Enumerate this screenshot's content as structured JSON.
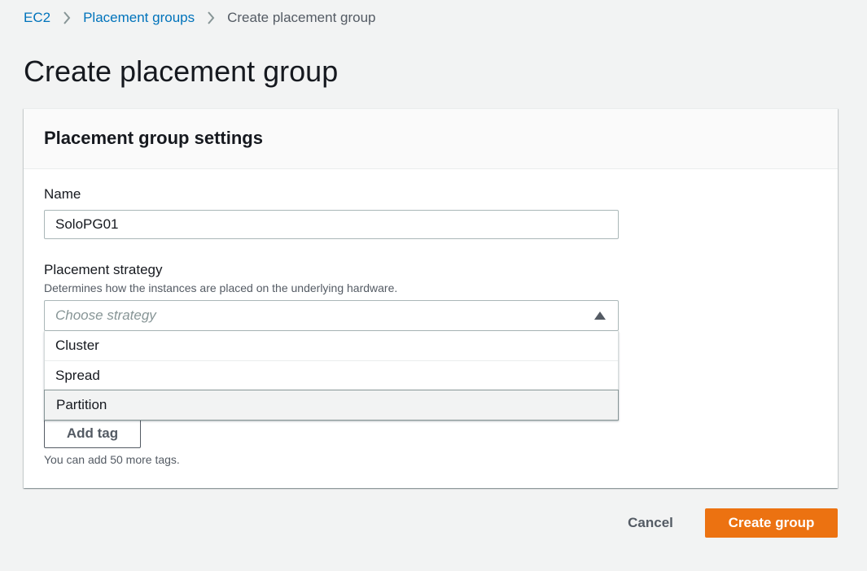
{
  "breadcrumb": {
    "items": [
      {
        "label": "EC2",
        "link": true
      },
      {
        "label": "Placement groups",
        "link": true
      },
      {
        "label": "Create placement group",
        "link": false
      }
    ],
    "separator_icon": "chevron-right-icon"
  },
  "page": {
    "title": "Create placement group"
  },
  "settings_panel": {
    "title": "Placement group settings",
    "name_field": {
      "label": "Name",
      "value": "SoloPG01"
    },
    "strategy_field": {
      "label": "Placement strategy",
      "description": "Determines how the instances are placed on the underlying hardware.",
      "placeholder": "Choose strategy",
      "expanded": true,
      "caret_icon": "caret-up-icon",
      "options": [
        "Cluster",
        "Spread",
        "Partition"
      ],
      "highlighted_option": "Partition"
    },
    "tags": {
      "add_tag_label": "Add tag",
      "hint": "You can add 50 more tags."
    }
  },
  "actions": {
    "cancel_label": "Cancel",
    "create_label": "Create group"
  },
  "colors": {
    "link": "#0073bb",
    "primary_button": "#ec7211",
    "page_background": "#f2f3f3"
  }
}
